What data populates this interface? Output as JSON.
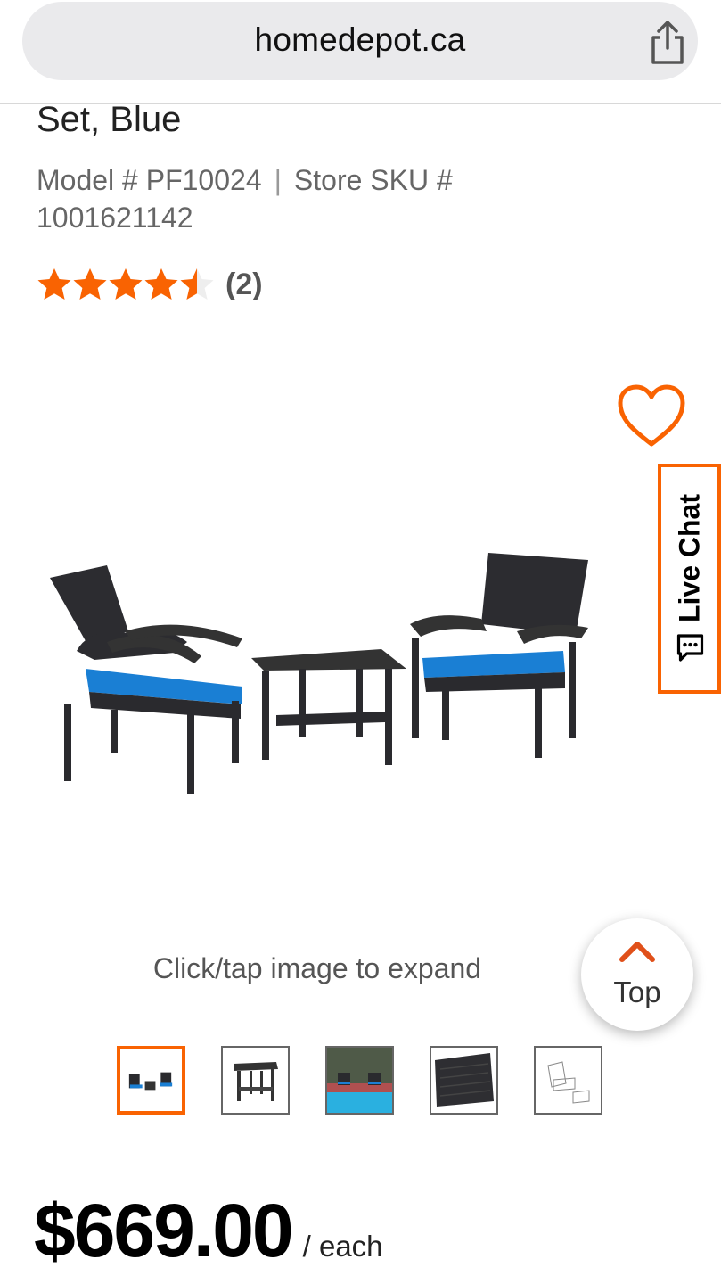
{
  "browser": {
    "url": "homedepot.ca",
    "share_icon": "share-icon"
  },
  "product": {
    "title_tail": "Set, Blue",
    "model_label": "Model # PF10024",
    "sku_label": "Store SKU #",
    "sku_value": "1001621142",
    "rating_value": 4.5,
    "rating_max": 5,
    "review_count": "(2)",
    "image_hint": "Click/tap image to expand",
    "price": "$669.00",
    "unit": "/ each"
  },
  "actions": {
    "top_label": "Top",
    "live_chat_label": "Live Chat"
  },
  "thumbnails": [
    {
      "name": "thumb-set",
      "selected": true
    },
    {
      "name": "thumb-table",
      "selected": false
    },
    {
      "name": "thumb-poolside",
      "selected": false
    },
    {
      "name": "thumb-wicker-detail",
      "selected": false
    },
    {
      "name": "thumb-sketch",
      "selected": false
    }
  ],
  "colors": {
    "accent": "#f96302",
    "cushion": "#1a7fd4",
    "wicker": "#2a2a2e"
  }
}
